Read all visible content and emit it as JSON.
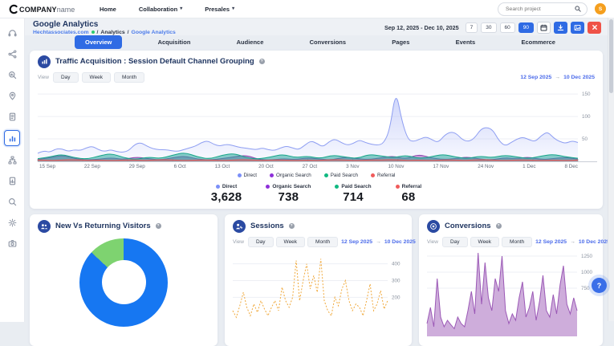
{
  "navbar": {
    "logo_bold": "COMPANY",
    "logo_light": "name",
    "menu": [
      {
        "label": "Home",
        "dropdown": false
      },
      {
        "label": "Collaboration",
        "dropdown": true
      },
      {
        "label": "Presales",
        "dropdown": true
      }
    ],
    "search_placeholder": "Search project",
    "avatar_initial": "S"
  },
  "subheader": {
    "title": "Google Analytics",
    "breadcrumb": {
      "site": "Hechtassociates.com",
      "sep": "/",
      "section": "Analytics",
      "current": "Google Analytics"
    },
    "date_range": "Sep 12, 2025 - Dec 10, 2025",
    "range_buttons": [
      {
        "label": "7"
      },
      {
        "label": "30"
      },
      {
        "label": "60"
      },
      {
        "label": "90",
        "active": true
      }
    ],
    "icon_buttons": [
      "calendar-icon",
      "download-icon",
      "image-export-icon",
      "excel-export-icon"
    ]
  },
  "tabs": [
    {
      "label": "Overview",
      "active": true
    },
    {
      "label": "Acquisition"
    },
    {
      "label": "Audience"
    },
    {
      "label": "Conversions"
    },
    {
      "label": "Pages"
    },
    {
      "label": "Events"
    },
    {
      "label": "Ecommerce"
    }
  ],
  "sidebar": {
    "icons": [
      "support-headset",
      "share-nodes",
      "search-analytics",
      "location-pin",
      "document",
      "bar-chart",
      "hierarchy",
      "report",
      "search",
      "settings-gear",
      "camera"
    ],
    "active_icon": "bar-chart"
  },
  "view_controls": {
    "label": "View",
    "options": [
      "Day",
      "Week",
      "Month"
    ]
  },
  "period": {
    "from": "12 Sep 2025",
    "arrow": "→",
    "to": "10 Dec 2025"
  },
  "main_card": {
    "title": "Traffic Acquisition : Session Default Channel Grouping",
    "legend": [
      {
        "label": "Direct",
        "color": "#7b8ff8"
      },
      {
        "label": "Organic Search",
        "color": "#8e30d9"
      },
      {
        "label": "Paid Search",
        "color": "#10b981"
      },
      {
        "label": "Referral",
        "color": "#f05b5b"
      }
    ],
    "stats": [
      {
        "label": "Direct",
        "value": "3,628",
        "color": "#7b8ff8"
      },
      {
        "label": "Organic Search",
        "value": "738",
        "color": "#8e30d9"
      },
      {
        "label": "Paid Search",
        "value": "714",
        "color": "#10b981"
      },
      {
        "label": "Referral",
        "value": "68",
        "color": "#f05b5b"
      }
    ]
  },
  "cards": {
    "visitors": {
      "title": "New Vs Returning Visitors"
    },
    "sessions": {
      "title": "Sessions"
    },
    "conversions": {
      "title": "Conversions"
    }
  },
  "help_button": "?",
  "chart_data": [
    {
      "id": "traffic",
      "type": "area",
      "title": "Traffic Acquisition : Session Default Channel Grouping",
      "x_labels": [
        "15 Sep",
        "22 Sep",
        "29 Sep",
        "6 Oct",
        "13 Oct",
        "20 Oct",
        "27 Oct",
        "3 Nov",
        "10 Nov",
        "17 Nov",
        "24 Nov",
        "1 Dec",
        "8 Dec"
      ],
      "ymax": 170,
      "gridlines": [
        50,
        100,
        150
      ],
      "label_pad": 24,
      "legend_position": "bottom",
      "series": [
        {
          "name": "Direct",
          "color": "#8e9ef2",
          "fill": "url(#dgrad)",
          "smooth": true,
          "values": [
            18,
            24,
            20,
            28,
            28,
            22,
            26,
            24,
            30,
            34,
            26,
            22,
            26,
            22,
            20,
            24,
            38,
            42,
            34,
            28,
            26,
            26,
            24,
            22,
            26,
            30,
            34,
            42,
            46,
            38,
            34,
            38,
            36,
            32,
            30,
            28,
            26,
            30,
            26,
            24,
            30,
            34,
            30,
            26,
            36,
            46,
            40,
            32,
            44,
            50,
            42,
            36,
            40,
            48,
            42,
            38,
            36,
            40,
            70,
            160,
            90,
            48,
            44,
            50,
            55,
            48,
            42,
            58,
            66,
            62,
            48,
            44,
            52,
            72,
            76,
            70,
            46,
            34,
            42,
            50,
            54,
            48,
            44,
            58,
            66,
            52,
            44,
            40,
            46,
            42
          ]
        },
        {
          "name": "Organic Search",
          "color": "#8e44ad",
          "fill": "rgba(142,68,173,0.5)",
          "smooth": true,
          "values": [
            4,
            8,
            14,
            6,
            3,
            5,
            8,
            4,
            10,
            6,
            3,
            8,
            12,
            5,
            3,
            6,
            10,
            14,
            4,
            3,
            6,
            4,
            8,
            5,
            3,
            10,
            6,
            4,
            8,
            12,
            5,
            16,
            8,
            4,
            6,
            10,
            5,
            3,
            8,
            6,
            10,
            4,
            6,
            9,
            5
          ]
        },
        {
          "name": "Paid Search",
          "color": "#17a689",
          "fill": "rgba(38,166,154,0.55)",
          "smooth": true,
          "values": [
            6,
            10,
            16,
            8,
            5,
            12,
            18,
            8,
            4,
            10,
            6,
            14,
            20,
            10,
            5,
            14,
            18,
            8,
            5,
            10,
            16,
            8,
            12,
            6,
            14,
            10,
            6,
            16,
            12,
            8,
            14,
            6,
            10,
            16,
            10,
            6,
            12,
            8,
            14,
            10,
            6,
            12,
            16,
            10,
            7
          ]
        },
        {
          "name": "Referral",
          "color": "#e85b5b",
          "fill": "rgba(232,91,91,0.4)",
          "smooth": true,
          "values": [
            3,
            2,
            3,
            4,
            2,
            3,
            2,
            3,
            3,
            2,
            4,
            3,
            2,
            3,
            3,
            2,
            3,
            4,
            2,
            3,
            3,
            2,
            3,
            2,
            4,
            3,
            2,
            3,
            3,
            4,
            2,
            3,
            2,
            3,
            3,
            2,
            4,
            3,
            2,
            3,
            3,
            2,
            3,
            2,
            3
          ]
        }
      ]
    },
    {
      "id": "sessions",
      "type": "line",
      "title": "Sessions",
      "ymax": 480,
      "gridlines": [
        200,
        300,
        400
      ],
      "label_pad": 22,
      "series": [
        {
          "name": "Sessions",
          "color": "#f0a93c",
          "fill": "none",
          "dash": "2 2",
          "smooth": false,
          "values": [
            120,
            80,
            150,
            230,
            140,
            90,
            160,
            110,
            180,
            130,
            90,
            140,
            180,
            120,
            260,
            180,
            140,
            200,
            420,
            180,
            300,
            400,
            250,
            330,
            230,
            430,
            180,
            120,
            90,
            200,
            150,
            250,
            300,
            180,
            120,
            160,
            140,
            90,
            180,
            280,
            120,
            160,
            240,
            130,
            180
          ]
        }
      ]
    },
    {
      "id": "conversions",
      "type": "area",
      "title": "Conversions",
      "ymax": 1350,
      "gridlines": [
        750,
        1000,
        1250
      ],
      "label_pad": 24,
      "series": [
        {
          "name": "Conversions",
          "color": "#9b59b6",
          "fill": "rgba(165,105,189,0.55)",
          "smooth": false,
          "values": [
            200,
            450,
            150,
            900,
            300,
            150,
            250,
            180,
            120,
            300,
            200,
            150,
            400,
            700,
            350,
            1300,
            500,
            1150,
            600,
            400,
            900,
            700,
            1250,
            400,
            200,
            350,
            250,
            600,
            850,
            300,
            450,
            700,
            250,
            550,
            950,
            400,
            300,
            650,
            350,
            800,
            1100,
            500,
            350,
            600,
            400
          ]
        }
      ]
    },
    {
      "id": "visitors",
      "type": "donut",
      "title": "New Vs Returning Visitors",
      "segments": [
        {
          "color": "#1677f2",
          "value": 87
        },
        {
          "color": "#7ed370",
          "value": 13
        }
      ]
    }
  ]
}
